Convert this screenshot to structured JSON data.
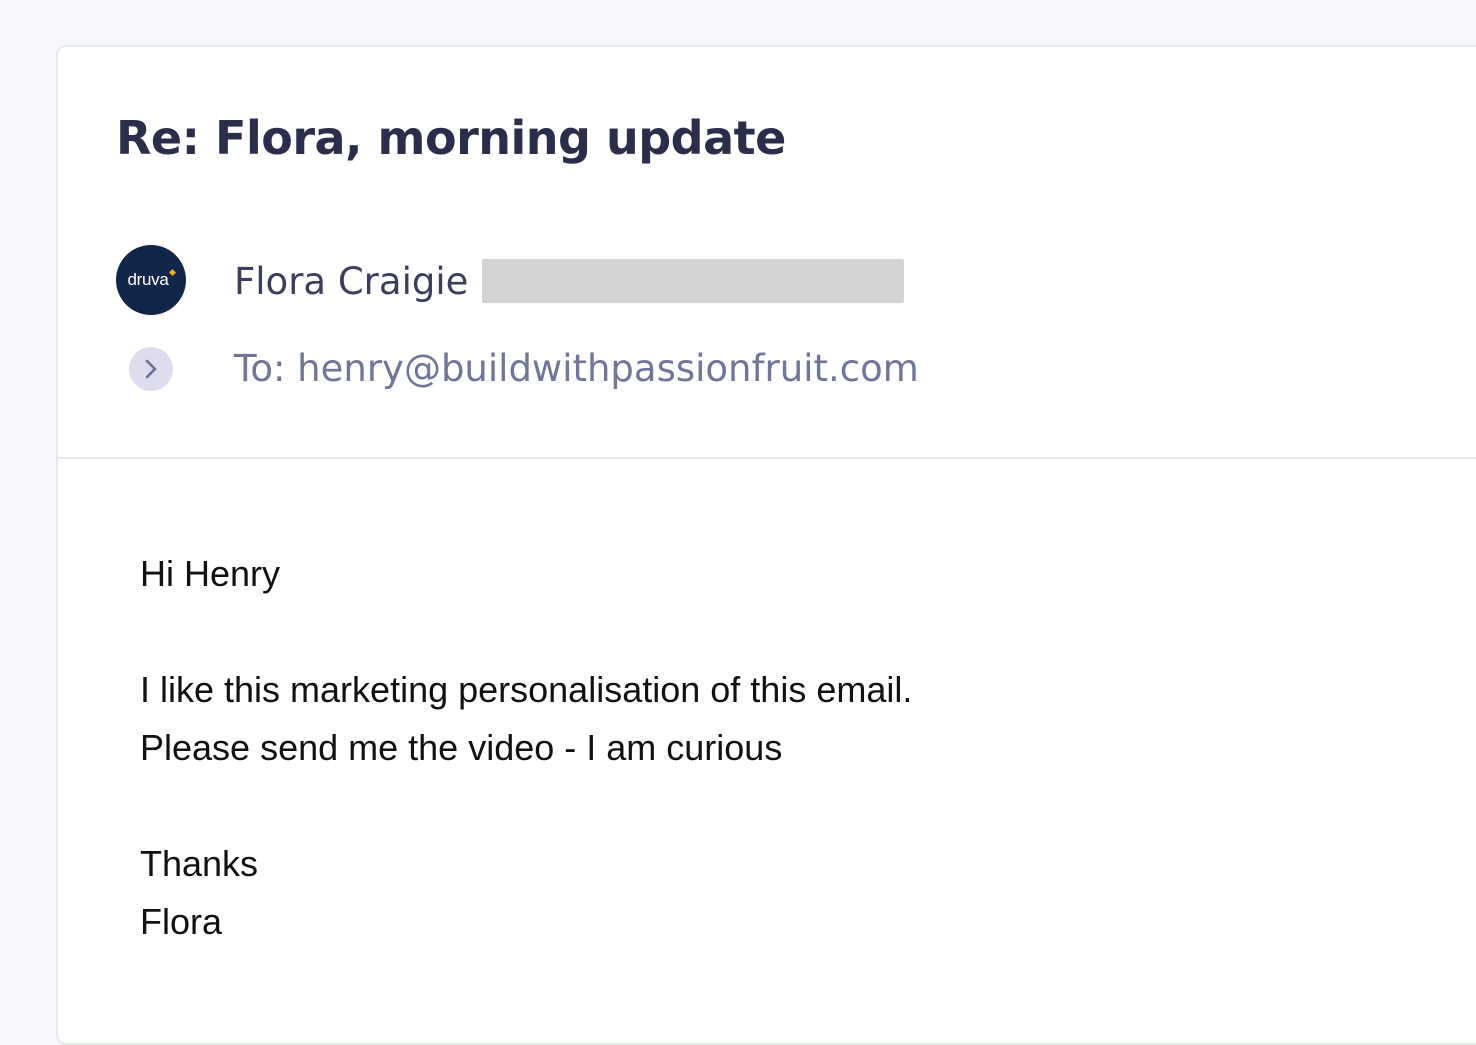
{
  "email": {
    "subject": "Re: Flora, morning update",
    "sender": {
      "name": "Flora Craigie",
      "avatar_logo_text": "druva",
      "email_redacted": true
    },
    "recipient": "To: henry@buildwithpassionfruit.com",
    "body": {
      "greeting": "Hi Henry",
      "line1": "I like this marketing personalisation of this email.",
      "line2": "Please send me the video - I am curious",
      "signoff": "Thanks",
      "signature": "Flora"
    }
  },
  "icons": {
    "expand": "chevron-right-icon",
    "avatar": "druva-logo-avatar"
  },
  "colors": {
    "background": "#f6f7fb",
    "card": "#ffffff",
    "subject_text": "#2b2e4a",
    "recipient_text": "#70759a",
    "avatar_bg": "#12264a",
    "avatar_accent": "#f5a623",
    "redaction": "#d3d3d3"
  }
}
